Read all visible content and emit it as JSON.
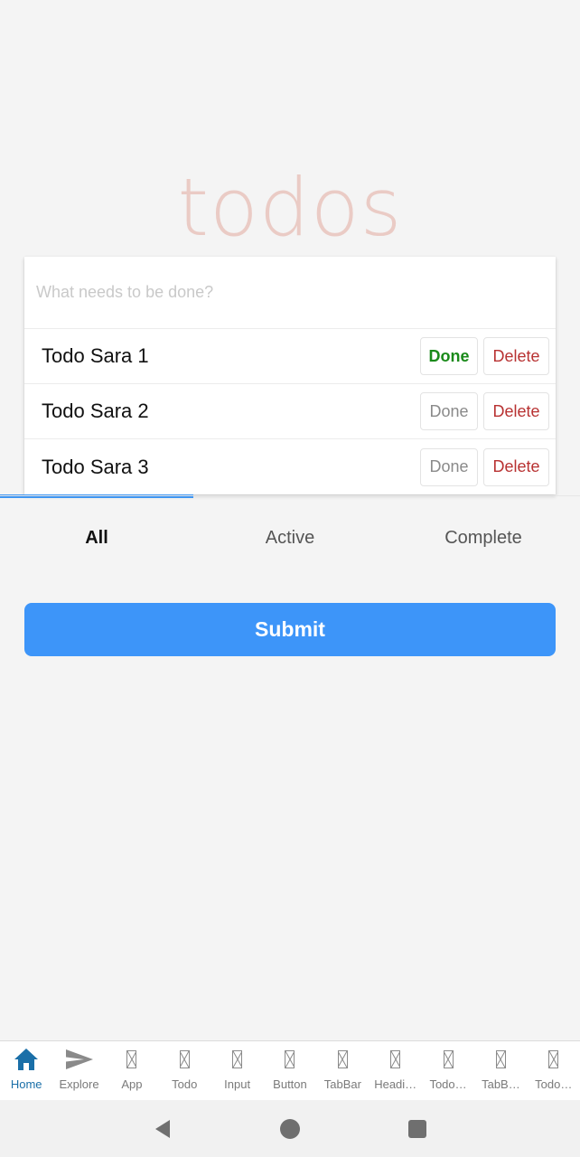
{
  "header": {
    "title": "todos"
  },
  "new_todo": {
    "placeholder": "What needs to be done?"
  },
  "todos": [
    {
      "text": "Todo Sara 1",
      "done_label": "Done",
      "delete_label": "Delete",
      "completed": true
    },
    {
      "text": "Todo Sara 2",
      "done_label": "Done",
      "delete_label": "Delete",
      "completed": false
    },
    {
      "text": "Todo Sara 3",
      "done_label": "Done",
      "delete_label": "Delete",
      "completed": false
    }
  ],
  "filter_tabs": {
    "selected": "All",
    "items": [
      {
        "label": "All"
      },
      {
        "label": "Active"
      },
      {
        "label": "Complete"
      }
    ]
  },
  "submit": {
    "label": "Submit"
  },
  "bottom_nav": {
    "selected": "Home",
    "items": [
      {
        "label": "Home",
        "icon": "home-icon"
      },
      {
        "label": "Explore",
        "icon": "send-icon"
      },
      {
        "label": "App",
        "icon": "missing-glyph-icon"
      },
      {
        "label": "Todo",
        "icon": "missing-glyph-icon"
      },
      {
        "label": "Input",
        "icon": "missing-glyph-icon"
      },
      {
        "label": "Button",
        "icon": "missing-glyph-icon"
      },
      {
        "label": "TabBar",
        "icon": "missing-glyph-icon"
      },
      {
        "label": "Headi…",
        "icon": "missing-glyph-icon"
      },
      {
        "label": "Todo…",
        "icon": "missing-glyph-icon"
      },
      {
        "label": "TabB…",
        "icon": "missing-glyph-icon"
      },
      {
        "label": "Todo…",
        "icon": "missing-glyph-icon"
      }
    ]
  },
  "system_nav": {
    "buttons": [
      "back-icon",
      "home-circle-icon",
      "recents-icon"
    ]
  },
  "colors": {
    "accent": "#3d95f9",
    "title": "#eacbc5",
    "done_completed": "#1a8a1a",
    "delete": "#b83232",
    "nav_active": "#1a6fa8"
  }
}
